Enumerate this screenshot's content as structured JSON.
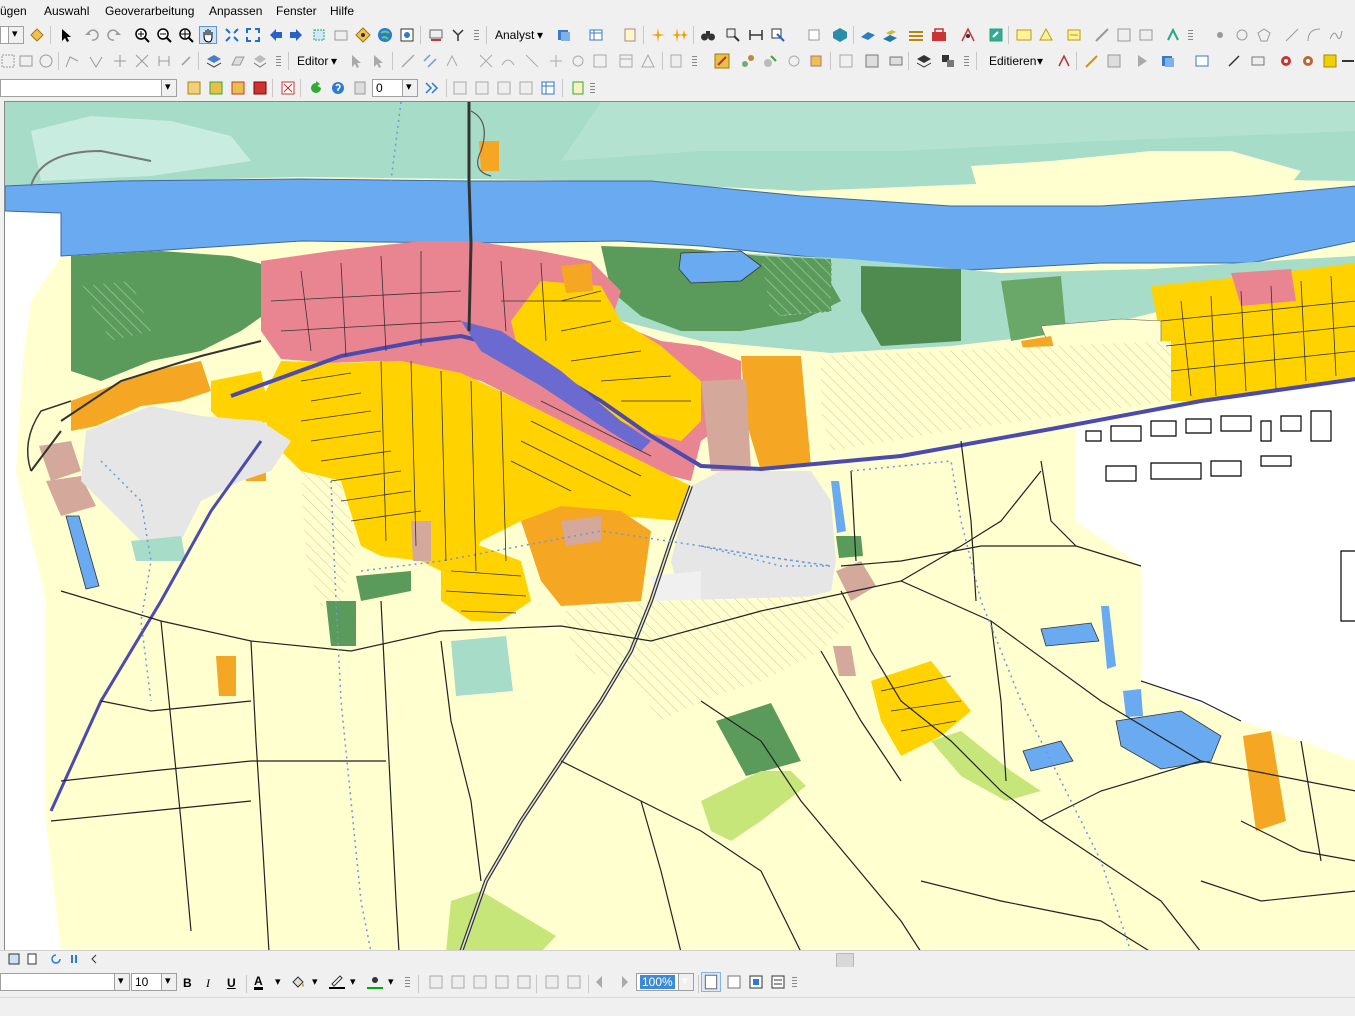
{
  "menu": {
    "items": [
      {
        "id": "einfuegen",
        "label": "ügen"
      },
      {
        "id": "auswahl",
        "label": "Auswahl"
      },
      {
        "id": "geoverarbeitung",
        "label": "Geoverarbeitung"
      },
      {
        "id": "anpassen",
        "label": "Anpassen"
      },
      {
        "id": "fenster",
        "label": "Fenster"
      },
      {
        "id": "hilfe",
        "label": "Hilfe"
      }
    ]
  },
  "toolbar1": {
    "analyst_label": "Analyst"
  },
  "toolbar2": {
    "editor_label": "Editor",
    "editieren_label": "Editieren"
  },
  "toolbar3": {
    "value_field": "0"
  },
  "draw_toolbar": {
    "font_size": "10",
    "bold_label": "B",
    "italic_label": "I",
    "underline_label": "U",
    "font_color_label": "A",
    "zoom_value": "100%"
  },
  "colors": {
    "water": "#6aaaf0",
    "residential": "#ffd200",
    "old_town": "#e98591",
    "commercial": "#f5a623",
    "forest": "#5a9a5a",
    "grassland": "#a7dcc8",
    "farmland": "#ffffd0",
    "industrial": "#e6e6e6",
    "special": "#d4a89a",
    "railway": "#4a4ab0"
  },
  "icons": {
    "toolbar1": [
      "select-icon",
      "undo-icon",
      "redo-icon",
      "zoom-in-icon",
      "zoom-out-icon",
      "fixed-zoom-icon",
      "pan-icon",
      "full-extent-icon",
      "fixed-zoom-out-icon",
      "back-icon",
      "forward-icon",
      "select-features-icon",
      "clear-selection-icon",
      "identify-icon",
      "globe-icon",
      "html-popup-icon",
      "measure-icon",
      "go-to-xy-icon"
    ],
    "drawing": [
      "select-elements-icon",
      "rotate-icon",
      "zoom-whole-page-icon",
      "zoom-in-page-icon",
      "zoom-out-page-icon"
    ]
  }
}
